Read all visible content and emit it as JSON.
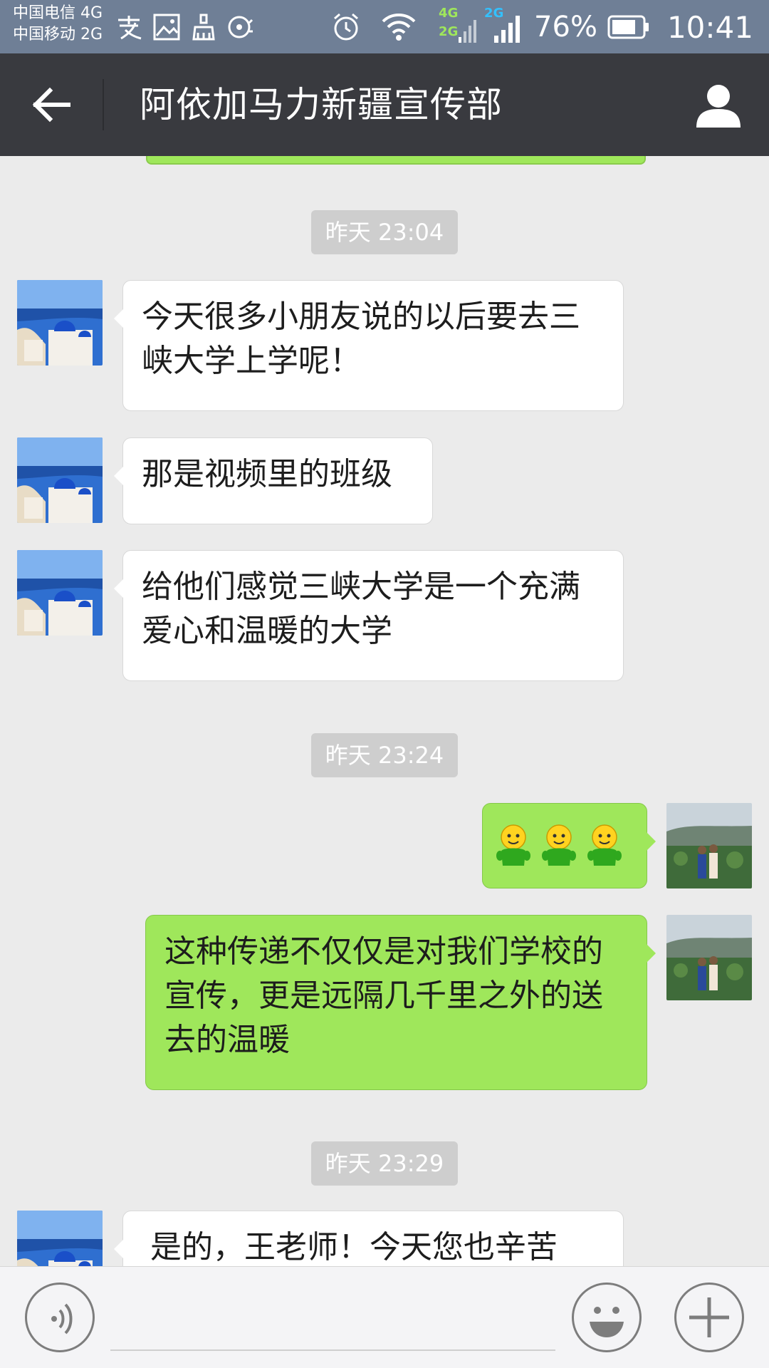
{
  "status_bar": {
    "carrier_1": "中国电信 4G",
    "carrier_2": "中国移动 2G",
    "net_1": "4G",
    "net_2": "2G",
    "net_3": "2G",
    "battery": "76%",
    "time": "10:41",
    "icons": [
      "alipay-icon",
      "image-icon",
      "clean-icon",
      "music-icon",
      "alarm-icon",
      "wifi-icon",
      "signal-icon",
      "battery-icon"
    ]
  },
  "header": {
    "title": "阿依加马力新疆宣传部",
    "back_icon": "back-arrow-icon",
    "profile_icon": "person-icon"
  },
  "messages": [
    {
      "type": "time",
      "text": "昨天 23:04"
    },
    {
      "type": "incoming",
      "text": "今天很多小朋友说的以后要去三峡大学上学呢！"
    },
    {
      "type": "incoming",
      "text": "那是视频里的班级"
    },
    {
      "type": "incoming",
      "text": "给他们感觉三峡大学是一个充满爱心和温暖的大学"
    },
    {
      "type": "time",
      "text": "昨天 23:24"
    },
    {
      "type": "outgoing",
      "content": "emoji",
      "emoji": "smiley-figure-icon",
      "count": 3
    },
    {
      "type": "outgoing",
      "text": "这种传递不仅仅是对我们学校的宣传，更是远隔几千里之外的送去的温暖"
    },
    {
      "type": "time",
      "text": "昨天 23:29"
    },
    {
      "type": "incoming",
      "text": "是的，王老师！今天您也辛苦"
    }
  ],
  "input_bar": {
    "voice_icon": "voice-icon",
    "emoji_icon": "emoji-icon",
    "plus_icon": "plus-icon",
    "input_value": ""
  },
  "colors": {
    "status_bar": "#6f7f96",
    "title_bar": "#393a3f",
    "chat_bg": "#ebebeb",
    "outgoing_bubble": "#9fe75b",
    "incoming_bubble": "#ffffff",
    "timestamp_bg": "#cecece"
  }
}
